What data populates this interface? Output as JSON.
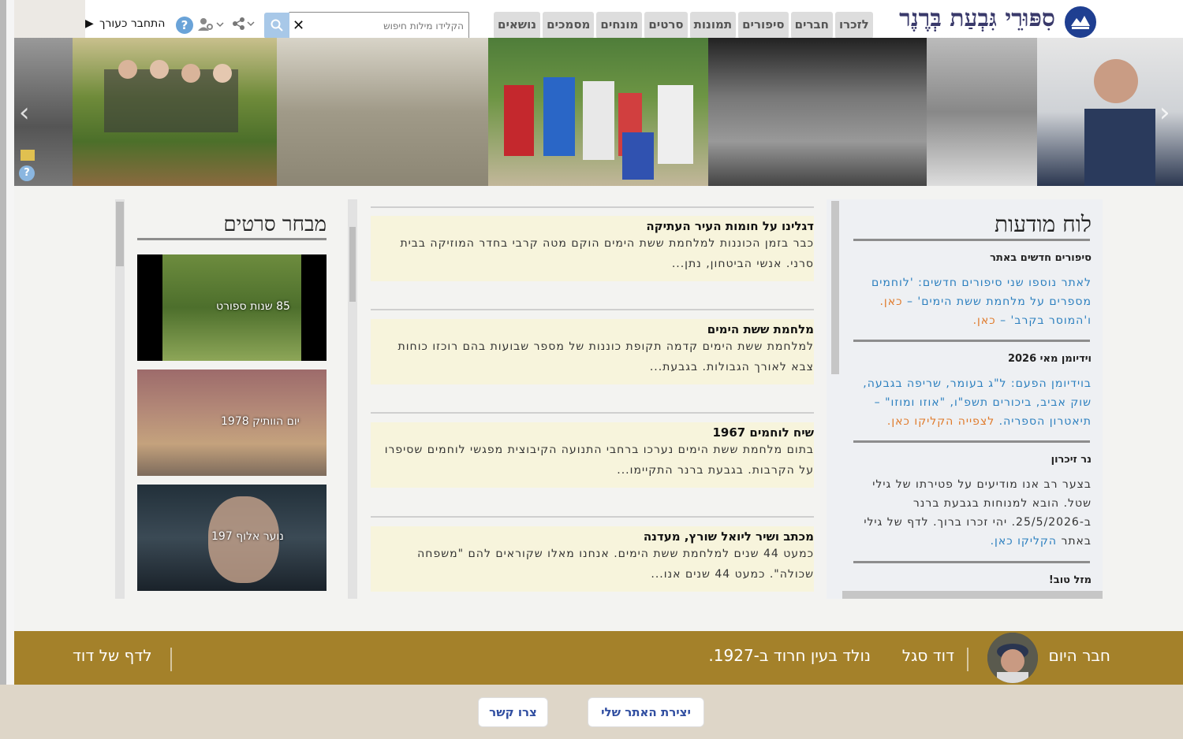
{
  "header": {
    "site_title": "סִפּוּרֵי גִּבְעַת בְּרֶנֶר",
    "nav": [
      "לזכרו",
      "חברים",
      "סיפורים",
      "תמונות",
      "סרטים",
      "מונחים",
      "מסמכים",
      "נושאים"
    ],
    "search_placeholder": "הקלידו מילות חיפוש",
    "login_label": "התחבר כעורך"
  },
  "board": {
    "title": "לוח מודעות",
    "sections": [
      {
        "heading": "סיפורים חדשים באתר",
        "text": "לאתר נוספו שני סיפורים חדשים: 'לוחמים מספרים על מלחמת ששת הימים' –",
        "link1": "כאן.",
        "text2": "ו'המוסר בקרב' –",
        "link2": "כאן."
      },
      {
        "heading": "וידיומן מאי 2026",
        "text": "בוידיומן הפעם: ל\"ג בעומר, שריפה בגבעה, שוק אביב, ביכורים תשפ\"ו, \"אוזו ומוזו\" – תיאטרון הספריה.",
        "link": "לצפייה הקליקו כאן."
      },
      {
        "heading": "נר זיכרון",
        "text": "בצער רב אנו מודיעים על פטירתו של גילי שטל. הובא למנוחות בגבעת ברנר ב-25/5/2026. יהי זכרו ברוך. לדף של גילי באתר",
        "link": "הקליקו כאן."
      },
      {
        "heading": "מזל טוב!"
      }
    ]
  },
  "stories": [
    {
      "title": "דגלינו על חומות העיר העתיקה",
      "excerpt": "כבר בזמן הכוננות למלחמת ששת הימים הוקם מטה קרבי בחדר המוזיקה בבית סרני. אנשי הביטחון, נתן..."
    },
    {
      "title": "מלחמת ששת הימים",
      "excerpt": "למלחמת ששת הימים קדמה תקופת כוננות של מספר שבועות בהם רוכזו כוחות צבא לאורך הגבולות. בגבעת..."
    },
    {
      "title": "שיח לוחמים 1967",
      "excerpt": "בתום מלחמת ששת הימים נערכו ברחבי התנועה הקיבוצית מפגשי לוחמים שסיפרו על הקרבות. בגבעת ברנר התקיימו..."
    },
    {
      "title": "מכתב ושיר ליואל שורץ, מעדנה",
      "excerpt": "כמעט 44 שנים למלחמת ששת הימים. אנחנו מאלו שקוראים להם \"משפחה שכולה\". כמעט 44 שנים אנו..."
    }
  ],
  "films": {
    "title": "מבחר סרטים",
    "items": [
      {
        "label": "85 שנות ספורט"
      },
      {
        "label": "יום הוותיק 1978"
      },
      {
        "label": "נוער אלוף 197"
      }
    ]
  },
  "member_of_day": {
    "heading": "חבר היום",
    "name": "דוד סגל",
    "info": "נולד בעין חרוד ב-1927.",
    "link": "לדף של דוד"
  },
  "footer": {
    "create_site": "יצירת האתר שלי",
    "contact": "צרו קשר"
  },
  "colors": {
    "bar": "#a4812a",
    "link": "#2b7fbf",
    "accent_orange": "#e07a2a",
    "story_bg": "#f7f4dc",
    "logo": "#1f3f91"
  }
}
